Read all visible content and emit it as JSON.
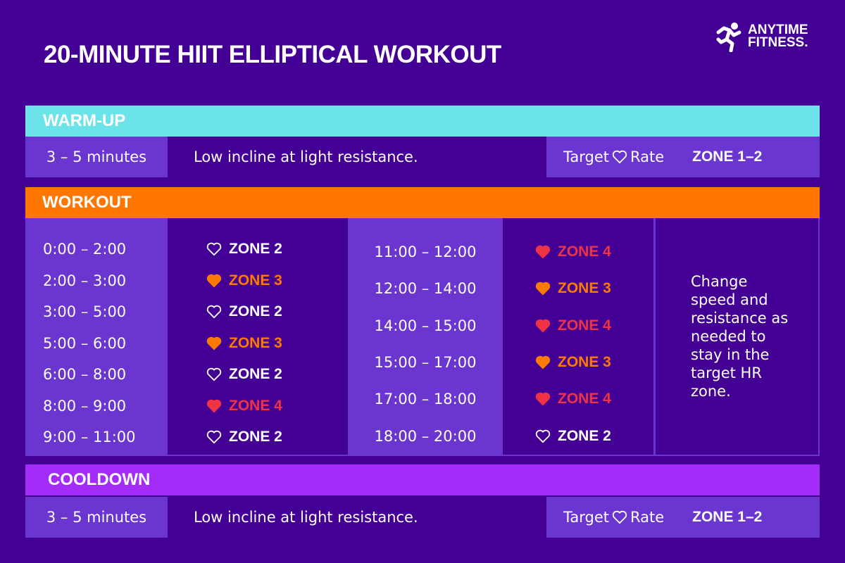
{
  "title": "20-MINUTE HIIT ELLIPTICAL WORKOUT",
  "logo": {
    "line1": "ANYTIME",
    "line2": "FITNESS.",
    "icon": "running-man-icon"
  },
  "colors": {
    "background": "#440094",
    "panel": "#6b35cf",
    "warmup": "#6be3e8",
    "workout": "#ff7600",
    "cooldown": "#a42cf8",
    "zone2": "#ffffff",
    "zone3": "#ff7a00",
    "zone4": "#ee3344"
  },
  "warmup": {
    "heading": "WARM-UP",
    "duration": "3 – 5 minutes",
    "description": "Low incline at light resistance.",
    "target_label_1": "Target",
    "target_label_2": "Rate",
    "target_zone": "ZONE 1–2"
  },
  "workout": {
    "heading": "WORKOUT",
    "intervals_left": [
      {
        "time": "0:00 – 2:00",
        "zone": "ZONE 2",
        "level": 2
      },
      {
        "time": "2:00 – 3:00",
        "zone": "ZONE 3",
        "level": 3
      },
      {
        "time": "3:00 – 5:00",
        "zone": "ZONE 2",
        "level": 2
      },
      {
        "time": "5:00 – 6:00",
        "zone": "ZONE 3",
        "level": 3
      },
      {
        "time": "6:00 – 8:00",
        "zone": "ZONE 2",
        "level": 2
      },
      {
        "time": "8:00 – 9:00",
        "zone": "ZONE 4",
        "level": 4
      },
      {
        "time": "9:00 – 11:00",
        "zone": "ZONE 2",
        "level": 2
      }
    ],
    "intervals_right": [
      {
        "time": "11:00 – 12:00",
        "zone": "ZONE 4",
        "level": 4
      },
      {
        "time": "12:00 – 14:00",
        "zone": "ZONE 3",
        "level": 3
      },
      {
        "time": "14:00 – 15:00",
        "zone": "ZONE 4",
        "level": 4
      },
      {
        "time": "15:00 – 17:00",
        "zone": "ZONE 3",
        "level": 3
      },
      {
        "time": "17:00 – 18:00",
        "zone": "ZONE 4",
        "level": 4
      },
      {
        "time": "18:00 – 20:00",
        "zone": "ZONE 2",
        "level": 2
      }
    ],
    "note": "Change speed and resistance as needed to stay in the target HR zone."
  },
  "cooldown": {
    "heading": "COOLDOWN",
    "duration": "3 – 5 minutes",
    "description": "Low incline at light resistance.",
    "target_label_1": "Target",
    "target_label_2": "Rate",
    "target_zone": "ZONE 1–2"
  }
}
